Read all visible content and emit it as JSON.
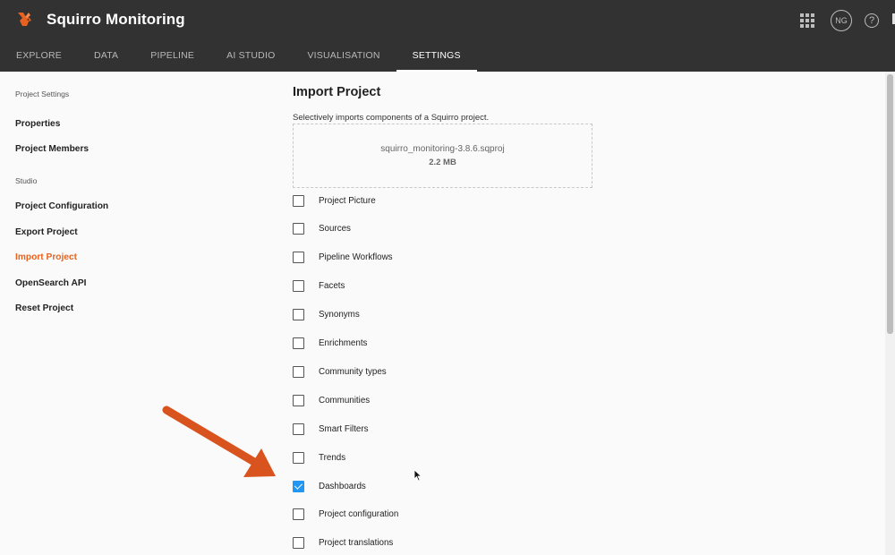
{
  "app": {
    "title": "Squirro Monitoring",
    "accent_color": "#e8621f",
    "topbar_color": "#323232",
    "check_color": "#2196f3",
    "logo_icon": "squirrel-logo-icon",
    "apps_icon": "apps-grid-icon",
    "user_initials": "NG",
    "help_icon": "help-icon"
  },
  "nav": {
    "tabs": [
      {
        "label": "EXPLORE",
        "active": false
      },
      {
        "label": "DATA",
        "active": false
      },
      {
        "label": "PIPELINE",
        "active": false
      },
      {
        "label": "AI STUDIO",
        "active": false
      },
      {
        "label": "VISUALISATION",
        "active": false
      },
      {
        "label": "SETTINGS",
        "active": true
      }
    ]
  },
  "sidebar": {
    "section_project": "Project Settings",
    "project_items": [
      {
        "label": "Properties",
        "active": false
      },
      {
        "label": "Project Members",
        "active": false
      }
    ],
    "section_studio": "Studio",
    "studio_items": [
      {
        "label": "Project Configuration",
        "active": false
      },
      {
        "label": "Export Project",
        "active": false
      },
      {
        "label": "Import Project",
        "active": true
      },
      {
        "label": "OpenSearch API",
        "active": false
      },
      {
        "label": "Reset Project",
        "active": false
      }
    ]
  },
  "main": {
    "title": "Import Project",
    "description": "Selectively imports components of a Squirro project.",
    "file": {
      "name": "squirro_monitoring-3.8.6.sqproj",
      "size": "2.2 MB"
    },
    "options": [
      {
        "label": "Project Picture",
        "checked": false
      },
      {
        "label": "Sources",
        "checked": false
      },
      {
        "label": "Pipeline Workflows",
        "checked": false
      },
      {
        "label": "Facets",
        "checked": false
      },
      {
        "label": "Synonyms",
        "checked": false
      },
      {
        "label": "Enrichments",
        "checked": false
      },
      {
        "label": "Community types",
        "checked": false
      },
      {
        "label": "Communities",
        "checked": false
      },
      {
        "label": "Smart Filters",
        "checked": false
      },
      {
        "label": "Trends",
        "checked": false
      },
      {
        "label": "Dashboards",
        "checked": true
      },
      {
        "label": "Project configuration",
        "checked": false
      },
      {
        "label": "Project translations",
        "checked": false
      }
    ]
  },
  "annotation": {
    "arrow_color": "#d9531e",
    "arrow_icon": "pointer-arrow-icon"
  }
}
